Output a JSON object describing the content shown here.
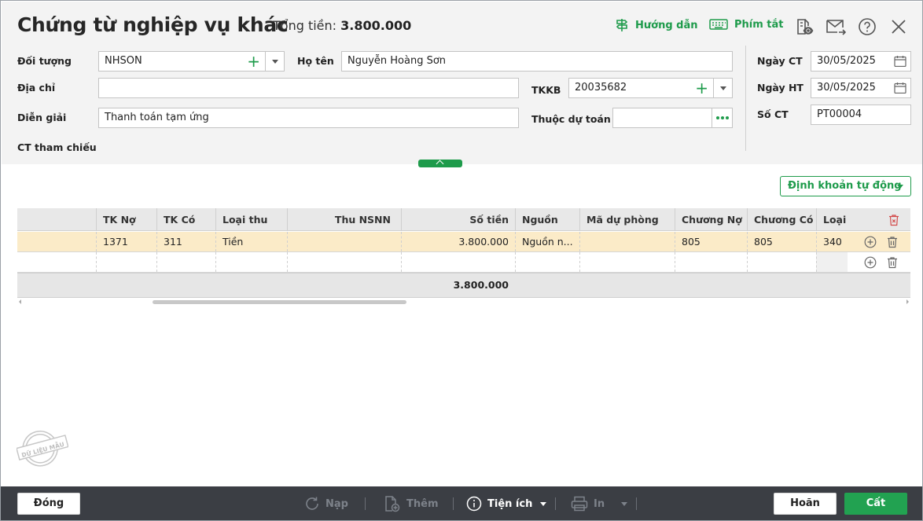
{
  "header": {
    "title": "Chứng từ nghiệp vụ khác",
    "total_label": "Tổng tiền:",
    "total_value": "3.800.000",
    "guide_label": "Hướng dẫn",
    "shortcut_label": "Phím tắt"
  },
  "form": {
    "doi_tuong": {
      "label": "Đối tượng",
      "value": "NHSON"
    },
    "ho_ten": {
      "label": "Họ tên",
      "value": "Nguyễn Hoàng Sơn"
    },
    "dia_chi": {
      "label": "Địa chỉ",
      "value": ""
    },
    "tkkb": {
      "label": "TKKB",
      "value": "20035682"
    },
    "dien_giai": {
      "label": "Diễn giải",
      "value": "Thanh toán tạm ứng"
    },
    "thuoc_du_toan": {
      "label": "Thuộc dự toán",
      "value": ""
    },
    "ct_tham_chieu": {
      "label": "CT tham chiếu"
    },
    "ngay_ct": {
      "label": "Ngày CT",
      "value": "30/05/2025"
    },
    "ngay_ht": {
      "label": "Ngày HT",
      "value": "30/05/2025"
    },
    "so_ct": {
      "label": "Số CT",
      "value": "PT00004"
    }
  },
  "auto_entry_label": "Định khoản tự động",
  "grid": {
    "columns": [
      "TK Nợ",
      "TK Có",
      "Loại thu",
      "Thu NSNN",
      "Số tiền",
      "Nguồn",
      "Mã dự phòng",
      "Chương Nợ",
      "Chương Có",
      "Loại k"
    ],
    "rows": [
      {
        "tk_no": "1371",
        "tk_co": "311",
        "loai_thu": "Tiền",
        "thu_nsnn": "",
        "so_tien": "3.800.000",
        "nguon": "Nguồn n...",
        "ma_du_phong": "",
        "chuong_no": "805",
        "chuong_co": "805",
        "loai_k": "340"
      }
    ],
    "total": "3.800.000"
  },
  "footer": {
    "close_label": "Đóng",
    "reload_label": "Nạp",
    "add_label": "Thêm",
    "utility_label": "Tiện ích",
    "print_label": "In",
    "cancel_label": "Hoãn",
    "save_label": "Cất"
  },
  "watermark": "DỮ LIỆU MẪU",
  "colors": {
    "accent": "#1e9b4b",
    "selected_row": "#fbebc8",
    "bottom_bar": "#3b3e44"
  }
}
